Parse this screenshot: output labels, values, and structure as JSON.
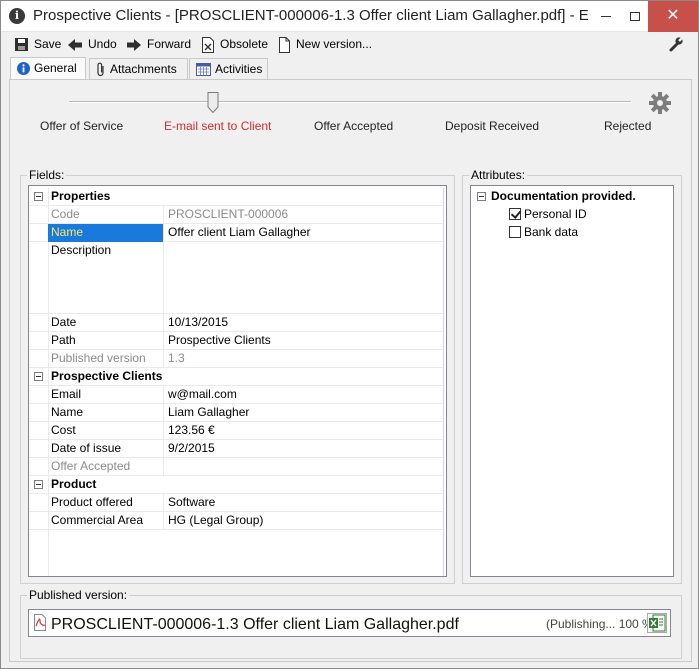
{
  "window": {
    "title": "Prospective Clients - [PROSCLIENT-000006-1.3 Offer client Liam Gallagher.pdf] - E-...",
    "close_glyph": "✕"
  },
  "toolbar": {
    "save": "Save",
    "undo": "Undo",
    "forward": "Forward",
    "obsolete": "Obsolete",
    "new_version": "New version..."
  },
  "tabs": [
    "General",
    "Attachments",
    "Activities"
  ],
  "workflow": {
    "states": [
      "Offer of Service",
      "E-mail sent to Client",
      "Offer Accepted",
      "Deposit Received",
      "Rejected"
    ],
    "current_state": "E-mail sent to Client",
    "accent": "#d22e2e"
  },
  "fields": {
    "title": "Fields:",
    "rows": [
      {
        "type": "category",
        "label": "Properties"
      },
      {
        "type": "readonly",
        "label": "Code",
        "value": "PROSCLIENT-000006"
      },
      {
        "type": "selected",
        "label": "Name",
        "value": "Offer client Liam Gallagher"
      },
      {
        "type": "multiline",
        "label": "Description",
        "value": ""
      },
      {
        "type": "field",
        "label": "Date",
        "value": "10/13/2015"
      },
      {
        "type": "field",
        "label": "Path",
        "value": "Prospective Clients"
      },
      {
        "type": "readonly",
        "label": "Published version",
        "value": "1.3"
      },
      {
        "type": "category",
        "label": "Prospective Clients"
      },
      {
        "type": "field",
        "label": "Email",
        "value": "w@mail.com"
      },
      {
        "type": "field",
        "label": "Name",
        "value": "Liam Gallagher"
      },
      {
        "type": "field",
        "label": "Cost",
        "value": "123.56 €"
      },
      {
        "type": "field",
        "label": "Date of issue",
        "value": "9/2/2015"
      },
      {
        "type": "readonly",
        "label": "Offer Accepted",
        "value": ""
      },
      {
        "type": "category",
        "label": "Product"
      },
      {
        "type": "field",
        "label": "Product offered",
        "value": "Software"
      },
      {
        "type": "field",
        "label": "Commercial Area",
        "value": "HG (Legal Group)"
      }
    ]
  },
  "attributes": {
    "title": "Attributes:",
    "group": "Documentation provided.",
    "items": [
      {
        "label": "Personal ID",
        "checked": true
      },
      {
        "label": "Bank data",
        "checked": false
      }
    ]
  },
  "published": {
    "title": "Published version:",
    "file_name": "PROSCLIENT-000006-1.3 Offer client Liam Gallagher.pdf",
    "status": "(Publishing... 100 %)"
  }
}
